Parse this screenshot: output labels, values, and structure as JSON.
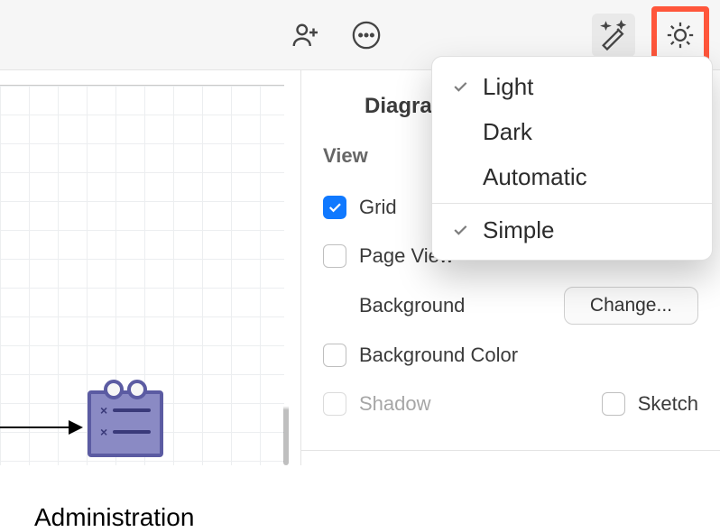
{
  "toolbar": {
    "share_icon": "person-add-icon",
    "more_icon": "more-icon",
    "wand_icon": "magic-wand-icon",
    "brightness_icon": "brightness-icon"
  },
  "canvas": {
    "node_label": "Administration"
  },
  "panel": {
    "tab_label": "Diagra",
    "section_view": "View",
    "grid_label": "Grid",
    "page_view_label": "Page View",
    "background_label": "Background",
    "change_btn": "Change...",
    "bg_color_label": "Background Color",
    "shadow_label": "Shadow",
    "sketch_label": "Sketch"
  },
  "popup": {
    "items": [
      {
        "label": "Light",
        "checked": true
      },
      {
        "label": "Dark",
        "checked": false
      },
      {
        "label": "Automatic",
        "checked": false
      }
    ],
    "secondary": [
      {
        "label": "Simple",
        "checked": true
      }
    ]
  }
}
